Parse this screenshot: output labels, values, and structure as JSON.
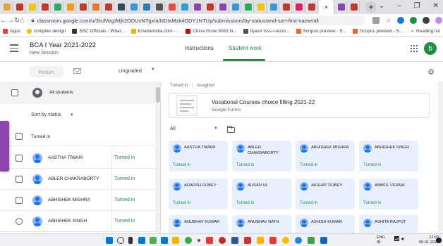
{
  "browser": {
    "url": "classroom.google.com/u/3/c/MzgIMjk2ODUxNTgx/a/NDIxMzk4ODY1NTUy/submissions/by-status/and-sort-first-name/all",
    "bookmarks": [
      "Apps",
      "compiler design",
      "SSC Officials - What...",
      "Khabarindia.com -...",
      "China Grow 9083 N...",
      "Ilyas# tsss-t-tecor...",
      "Scopus preview - S...",
      "Scopus preview - S..."
    ],
    "reading_list": "Reading list"
  },
  "header": {
    "class_title": "BCA I Year 2021-2022",
    "class_subtitle": "New Session",
    "tab_instructions": "Instructions",
    "tab_student_work": "Student work",
    "avatar_letter": "b"
  },
  "toolbar": {
    "return_label": "Return",
    "grade_select": "Ungraded"
  },
  "left_panel": {
    "all_students": "All students",
    "sort_label": "Sort by status",
    "section_turned_in": "Turned in",
    "students": [
      {
        "name": "AASTHA TIWARI",
        "status": "Turned in"
      },
      {
        "name": "ABLER CHAKRABORTY",
        "status": "Turned in"
      },
      {
        "name": "ABHISHEK MISHRA",
        "status": "Turned in"
      },
      {
        "name": "ABHISHEK SINGH",
        "status": "Turned in"
      }
    ]
  },
  "right_panel": {
    "count_turned_in": "Turned in",
    "count_assigned": "Assigned",
    "assignment_title": "Vocational Courses choice filling 2021-22",
    "assignment_source": "Google Forms",
    "filter_label": "All",
    "cards": [
      {
        "name": "AASTHA TIWARI",
        "status": "Turned in"
      },
      {
        "name": "ABLER CHAKRABORTY",
        "status": "Turned in"
      },
      {
        "name": "ABHISHEK MISHRA",
        "status": "Turned in"
      },
      {
        "name": "ABHISHEK SINGH",
        "status": "Turned in"
      },
      {
        "name": "ADARSH DUBEY",
        "status": "Turned in"
      },
      {
        "name": "AHSAN UL",
        "status": "Turned in"
      },
      {
        "name": "AKSHAT DUBEY",
        "status": "Turned in"
      },
      {
        "name": "ANMOL VERMA",
        "status": "Turned in"
      },
      {
        "name": "ANUBHAV KUMAR",
        "status": ""
      },
      {
        "name": "ANUBHAV NATH",
        "status": ""
      },
      {
        "name": "ASHISH KUMAR",
        "status": ""
      },
      {
        "name": "ASHITA RAJPUT",
        "status": ""
      }
    ]
  },
  "taskbar": {
    "lang": "ENG",
    "region": "IN",
    "time": "12:02",
    "date": "05-01-2022"
  },
  "colors": {
    "accent_green": "#1e8e3e",
    "card_bg": "#e8f0fe",
    "overlay_purple": "#8e44ad"
  }
}
